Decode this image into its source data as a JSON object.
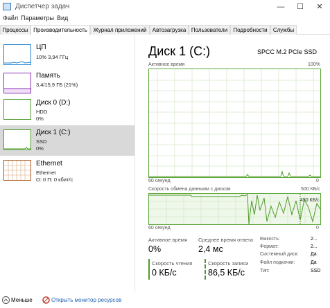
{
  "window": {
    "title": "Диспетчер задач",
    "controls": {
      "minimize": "—",
      "maximize": "☐",
      "close": "✕"
    }
  },
  "menu": [
    "Файл",
    "Параметры",
    "Вид"
  ],
  "tabs": [
    "Процессы",
    "Производительность",
    "Журнал приложений",
    "Автозагрузка",
    "Пользователи",
    "Подробности",
    "Службы"
  ],
  "active_tab": "Производительность",
  "resources": [
    {
      "name": "ЦП",
      "line1": "10% 3,94 ГГц",
      "line2": "",
      "color": "#1c7ecf"
    },
    {
      "name": "Память",
      "line1": "3,4/15,9 ГБ (21%)",
      "line2": "",
      "color": "#8b2fb5"
    },
    {
      "name": "Диск 0 (D:)",
      "line1": "HDD",
      "line2": "0%",
      "color": "#4e9a2a"
    },
    {
      "name": "Диск 1 (C:)",
      "line1": "SSD",
      "line2": "0%",
      "color": "#4e9a2a",
      "selected": true
    },
    {
      "name": "Ethernet",
      "line1": "Ethernet",
      "line2": "О: 0 П: 0 кбит/с",
      "color": "#a7541a"
    }
  ],
  "detail": {
    "title": "Диск 1 (C:)",
    "model": "SPCC M.2 PCIe SSD",
    "graph1": {
      "label": "Активное время",
      "max": "100%",
      "time": "60 секунд",
      "min": "0"
    },
    "graph2": {
      "label": "Скорость обмена данными с диском",
      "max": "500 КБ/с",
      "marker": "450 КБ/с",
      "time": "60 секунд",
      "min": "0"
    },
    "stats": {
      "active_label": "Активное время",
      "active_value": "0%",
      "resp_label": "Среднее время ответа",
      "resp_value": "2,4 мс",
      "read_label": "Скорость чтения",
      "read_value": "0 КБ/с",
      "write_label": "Скорость записи",
      "write_value": "86,5 КБ/с"
    },
    "props": [
      {
        "label": "Емкость:",
        "value": "2..."
      },
      {
        "label": "Формат:",
        "value": "2..."
      },
      {
        "label": "Системный диск:",
        "value": "Да"
      },
      {
        "label": "Файл подкачки:",
        "value": "Да"
      },
      {
        "label": "Тип:",
        "value": "SSD"
      }
    ]
  },
  "footer": {
    "less": "Меньше",
    "monitor": "Открыть монитор ресурсов"
  },
  "colors": {
    "disk_green": "#4e9a2a",
    "grid": "#dfeed6"
  }
}
